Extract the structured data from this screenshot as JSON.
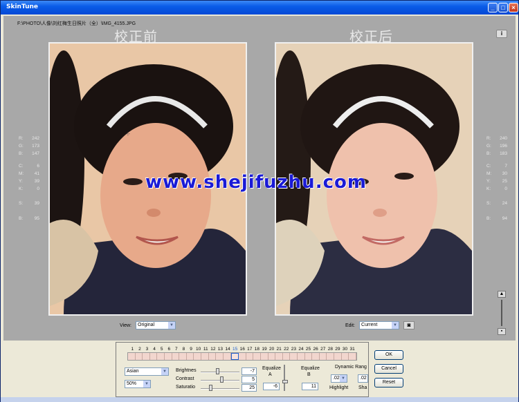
{
  "window": {
    "title": "SkinTune",
    "path": "F:\\PHOTO\\人像\\刘红梅生日照片（全）\\IMG_4155.JPG",
    "info_label": "i",
    "min": "_",
    "max": "□",
    "close": "×"
  },
  "before": {
    "label": "校正前"
  },
  "after": {
    "label": "校正后"
  },
  "watermark": "www.shejifuzhu.com",
  "left_readout": [
    {
      "k": "R:",
      "v": "242"
    },
    {
      "k": "G:",
      "v": "173"
    },
    {
      "k": "B:",
      "v": "147"
    },
    {
      "k": "C:",
      "v": "6"
    },
    {
      "k": "M:",
      "v": "41"
    },
    {
      "k": "Y:",
      "v": "39"
    },
    {
      "k": "K:",
      "v": "0"
    },
    {
      "k": "S:",
      "v": "39"
    },
    {
      "k": "B:",
      "v": "95"
    }
  ],
  "right_readout": [
    {
      "k": "R:",
      "v": "240"
    },
    {
      "k": "G:",
      "v": "196"
    },
    {
      "k": "B:",
      "v": "183"
    },
    {
      "k": "C:",
      "v": "7"
    },
    {
      "k": "M:",
      "v": "30"
    },
    {
      "k": "Y:",
      "v": "25"
    },
    {
      "k": "K:",
      "v": "0"
    },
    {
      "k": "S:",
      "v": "24"
    },
    {
      "k": "B:",
      "v": "94"
    }
  ],
  "view": {
    "label": "View:",
    "value": "Original"
  },
  "edit": {
    "label": "Edit:",
    "value": "Current"
  },
  "strip": {
    "numbers": [
      "1",
      "2",
      "3",
      "4",
      "5",
      "6",
      "7",
      "8",
      "9",
      "10",
      "11",
      "12",
      "13",
      "14",
      "15",
      "16",
      "17",
      "18",
      "19",
      "20",
      "21",
      "22",
      "23",
      "24",
      "25",
      "26",
      "27",
      "28",
      "29",
      "30",
      "31"
    ],
    "selected": 15
  },
  "controls": {
    "skin": "Asian",
    "zoom": "50%",
    "brightness_label": "Brightnes",
    "brightness": "-7",
    "contrast_label": "Contrast",
    "contrast": "5",
    "saturation_label": "Saturatio",
    "saturation": "25",
    "equalize_a_label": "Equalize",
    "equalize_a_sub": "A",
    "equalize_a": "-6",
    "equalize_b_label": "Equalize",
    "equalize_b_sub": "B",
    "equalize_b": "11",
    "dynamic_label": "Dynamic Rang",
    "highlight_value": ".02",
    "highlight_label": "Highlight",
    "shadow_value": ".02",
    "shadow_label": "Sha"
  },
  "buttons": {
    "ok": "OK",
    "cancel": "Cancel",
    "reset": "Reset"
  },
  "colors": {
    "titlebar": "#0a5ce8",
    "canvas": "#a8a8a8",
    "watermark": "#1a1ad6",
    "selected": "#2060d0"
  }
}
